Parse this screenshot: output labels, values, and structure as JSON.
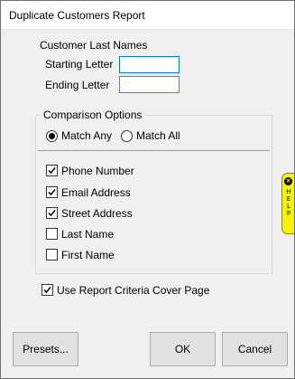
{
  "window": {
    "title": "Duplicate Customers Report"
  },
  "names": {
    "heading": "Customer Last Names",
    "starting_label": "Starting Letter",
    "starting_value": "",
    "ending_label": "Ending Letter",
    "ending_value": ""
  },
  "comparison": {
    "title": "Comparison Options",
    "match_any": {
      "label": "Match Any",
      "selected": true
    },
    "match_all": {
      "label": "Match All",
      "selected": false
    },
    "fields": [
      {
        "label": "Phone Number",
        "checked": true
      },
      {
        "label": "Email Address",
        "checked": true
      },
      {
        "label": "Street Address",
        "checked": true
      },
      {
        "label": "Last Name",
        "checked": false
      },
      {
        "label": "First Name",
        "checked": false
      }
    ]
  },
  "cover_page": {
    "label": "Use Report Criteria Cover Page",
    "checked": true
  },
  "help": {
    "text": "HELP",
    "icon": "close-icon"
  },
  "buttons": {
    "presets": "Presets...",
    "ok": "OK",
    "cancel": "Cancel"
  }
}
